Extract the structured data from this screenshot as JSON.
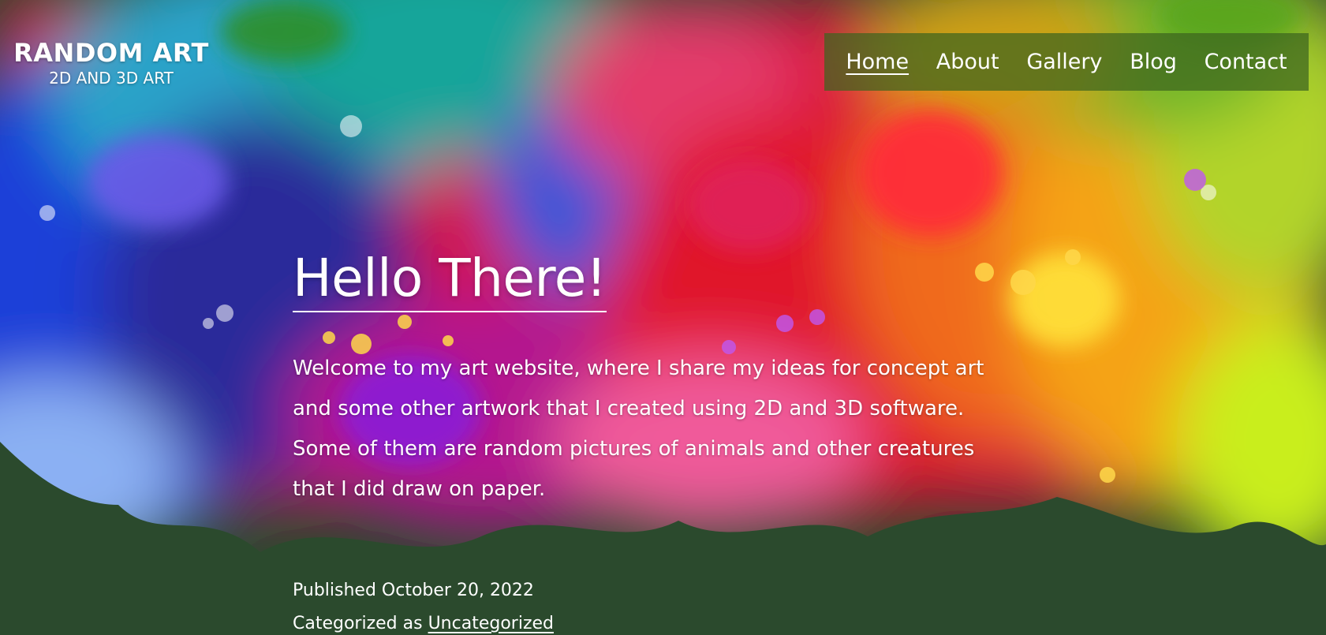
{
  "site": {
    "title": "RANDOM ART",
    "description": "2D AND 3D ART"
  },
  "nav": {
    "items": [
      {
        "label": "Home",
        "current": true
      },
      {
        "label": "About",
        "current": false
      },
      {
        "label": "Gallery",
        "current": false
      },
      {
        "label": "Blog",
        "current": false
      },
      {
        "label": "Contact",
        "current": false
      }
    ]
  },
  "post": {
    "title": "Hello There!",
    "body": "Welcome to my art website, where I share my ideas for concept art and some other artwork that I created using 2D and 3D software. Some of them are random pictures of animals and other creatures that I did draw on paper.",
    "published_label": "Published",
    "published_date": "October 20, 2022",
    "categorized_label": "Categorized as",
    "category": "Uncategorized"
  },
  "colors": {
    "footer_green": "#2b4a2d",
    "nav_overlay": "#3c641e",
    "text": "#ffffff"
  }
}
